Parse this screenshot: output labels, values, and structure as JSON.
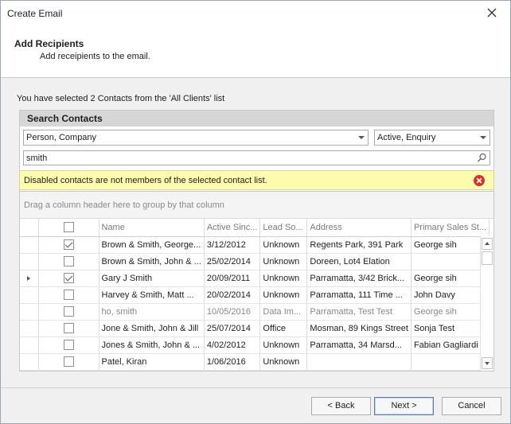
{
  "window": {
    "title": "Create Email"
  },
  "header": {
    "title": "Add Recipients",
    "subtitle": "Add receipients to the email."
  },
  "selection_info": "You have selected 2 Contacts from the 'All Clients' list",
  "search_panel": {
    "title": "Search Contacts",
    "type_filter": "Person, Company",
    "status_filter": "Active, Enquiry",
    "search_text": "smith"
  },
  "warning": {
    "text": "Disabled contacts are not members of the selected contact list."
  },
  "grid": {
    "group_hint": "Drag a column header here to group by that column",
    "columns": [
      "Name",
      "Active Sinc...",
      "Lead So...",
      "Address",
      "Primary Sales St..."
    ],
    "rows": [
      {
        "checked": true,
        "focused": false,
        "disabled": false,
        "cells": [
          "Brown & Smith, George...",
          "3/12/2012",
          "Unknown",
          "Regents Park, 391 Park",
          "George sih"
        ]
      },
      {
        "checked": false,
        "focused": false,
        "disabled": false,
        "cells": [
          "Brown & Smith, John & ...",
          "25/02/2014",
          "Unknown",
          "Doreen, Lot4 Elation",
          ""
        ]
      },
      {
        "checked": true,
        "focused": true,
        "disabled": false,
        "cells": [
          "Gary J Smith",
          "20/09/2011",
          "Unknown",
          "Parramatta, 3/42 Brick...",
          "George sih"
        ]
      },
      {
        "checked": false,
        "focused": false,
        "disabled": false,
        "cells": [
          "Harvey & Smith, Matt ...",
          "20/02/2014",
          "Unknown",
          "Parramatta, 111 Time ...",
          "John Davy"
        ]
      },
      {
        "checked": false,
        "focused": false,
        "disabled": true,
        "cells": [
          "ho, smith",
          "10/05/2016",
          "Data Im...",
          "Parramatta, Test Test",
          "George sih"
        ]
      },
      {
        "checked": false,
        "focused": false,
        "disabled": false,
        "cells": [
          "Jone & Smith, John & Jill",
          "25/07/2014",
          "Office",
          "Mosman, 89 Kings Street",
          "Sonja Test"
        ]
      },
      {
        "checked": false,
        "focused": false,
        "disabled": false,
        "cells": [
          "Jones & Smith, John & ...",
          "4/02/2012",
          "Unknown",
          "Parramatta, 34 Marsd...",
          "Fabian Gagliardi"
        ]
      },
      {
        "checked": false,
        "focused": false,
        "disabled": false,
        "cells": [
          "Patel, Kiran",
          "1/06/2016",
          "Unknown",
          "",
          ""
        ]
      }
    ]
  },
  "buttons": {
    "back": "< Back",
    "next": "Next >",
    "cancel": "Cancel"
  },
  "colors": {
    "warning_bg": "#fdfbad",
    "error_icon": "#d9302c",
    "primary_border": "#5b80b2"
  },
  "icons": {
    "close": "close-icon",
    "search": "search-icon",
    "error": "error-circle-icon",
    "row_indicator": "row-indicator-icon"
  }
}
